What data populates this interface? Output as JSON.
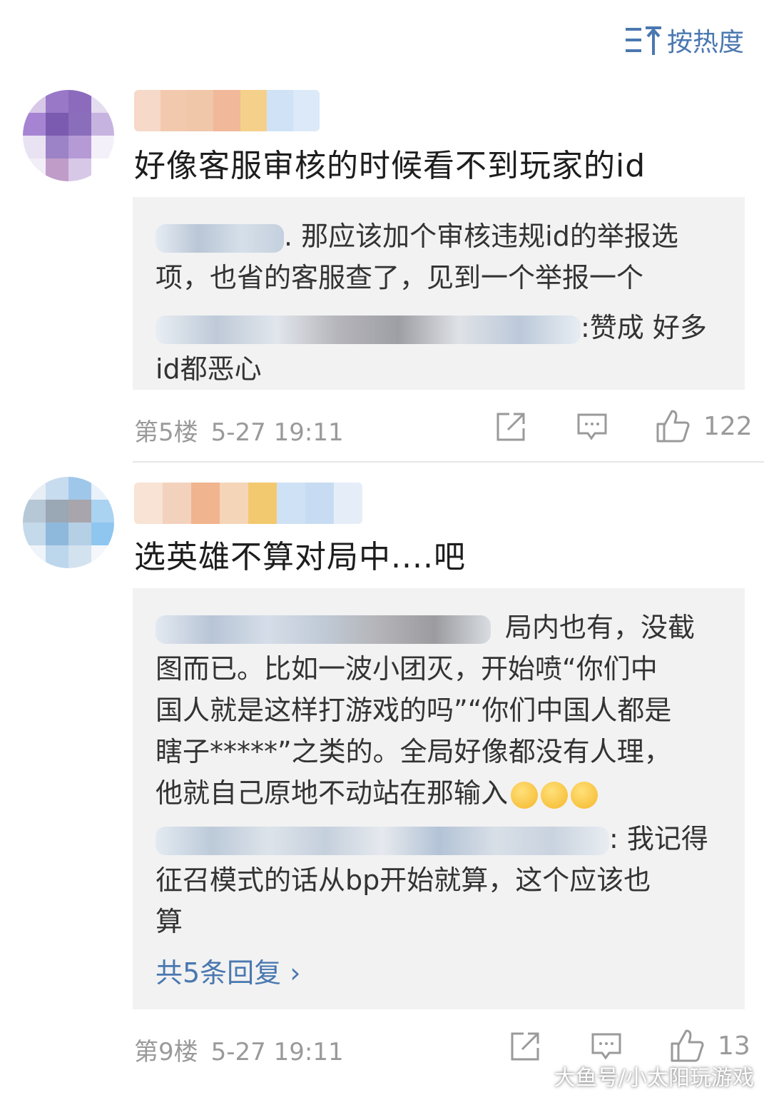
{
  "sort_label": "按热度",
  "comments": [
    {
      "text": "好像客服审核的时候看不到玩家的id",
      "replies": [
        {
          "text_lines": [
            ". 那应该加个审核违规id的举报选",
            "项，也省的客服查了，见到一个举报一个"
          ]
        },
        {
          "text_lines": [
            ":赞成 好多",
            "id都恶心"
          ]
        }
      ],
      "floor": "第5楼",
      "time": "5-27 19:11",
      "likes": "122"
    },
    {
      "text": "选英雄不算对局中....吧",
      "replies": [
        {
          "text_lines": [
            "局内也有，没截",
            "图而已。比如一波小团灭，开始喷“你们中",
            "国人就是这样打游戏的吗”“你们中国人都是",
            "瞎子*****”之类的。全局好像都没有人理，",
            "他就自己原地不动站在那输入"
          ]
        },
        {
          "text_lines": [
            ": 我记得",
            "征召模式的话从bp开始就算，这个应该也",
            "算"
          ]
        }
      ],
      "more_replies": "共5条回复 ›",
      "floor": "第9楼",
      "time": "5-27 19:11",
      "likes": "13"
    }
  ],
  "watermark": "大鱼号/小太阳玩游戏",
  "colors": {
    "accent": "#4a78b0",
    "meta": "#9a9a9a",
    "reply_bg": "#f2f2f2"
  }
}
